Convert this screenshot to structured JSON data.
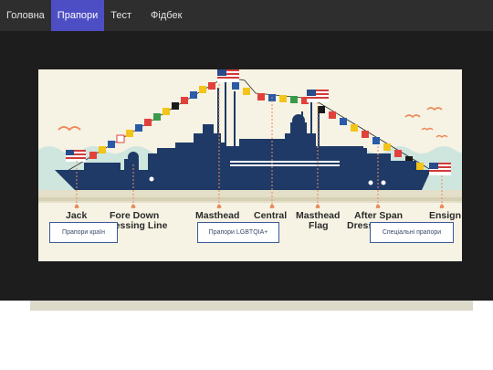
{
  "nav": {
    "items": [
      {
        "label": "Головна",
        "active": false
      },
      {
        "label": "Прапори",
        "active": true
      },
      {
        "label": "Тест",
        "active": false
      },
      {
        "label": "Фідбек",
        "active": false
      }
    ]
  },
  "poster": {
    "labels": {
      "jack": "Jack",
      "fore_down": "Fore Down",
      "dressing_line": "Dressing Line",
      "masthead_1": "Masthead",
      "central": "Central",
      "masthead_flag": "Masthead",
      "flag_word": "Flag",
      "after_span": "After Span",
      "dress": "Dress",
      "ensign": "Ensign"
    }
  },
  "buttons": {
    "country_flags": "Прапори країн",
    "lgbtqia_flags": "Прапори LGBTQIA+",
    "special_flags": "Спеціальні прапори"
  },
  "colors": {
    "nav_bg": "#2e2e2e",
    "nav_active": "#4e4ec4",
    "stage_bg": "#1d1d1d",
    "poster_bg": "#f6f3e4",
    "ship_navy": "#1f3a66",
    "water": "#cfe6df"
  }
}
